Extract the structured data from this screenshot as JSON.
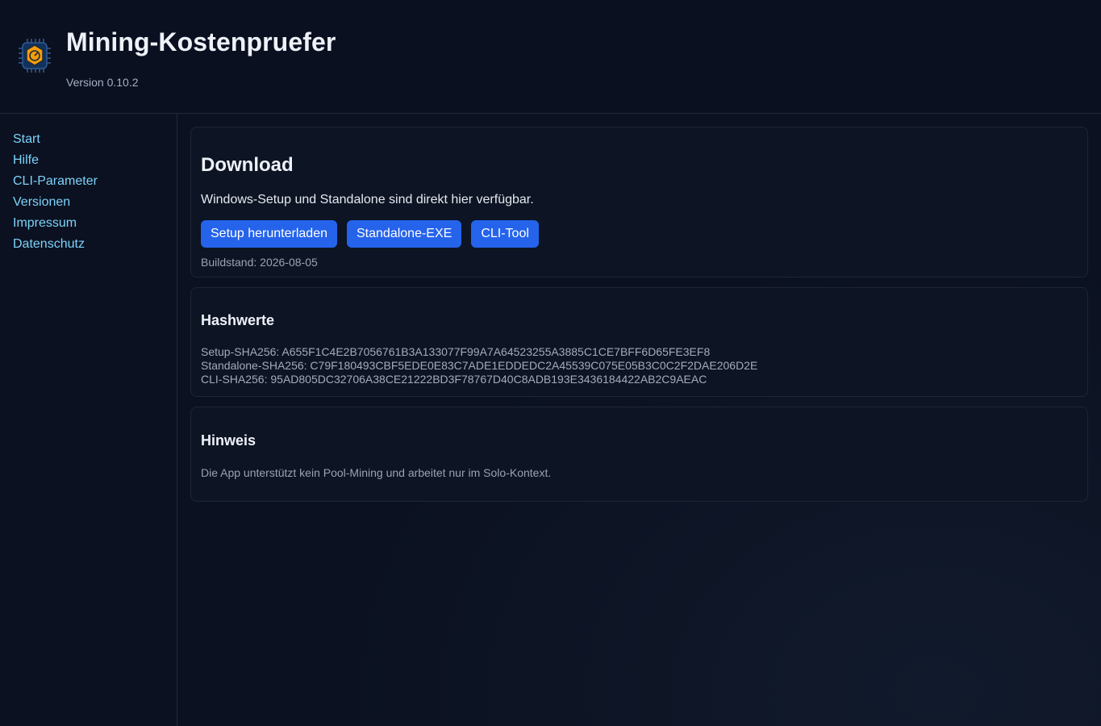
{
  "header": {
    "title": "Mining-Kostenpruefer",
    "version": "Version 0.10.2",
    "logo_icon": "chip-gauge-icon"
  },
  "sidebar": {
    "items": [
      {
        "label": "Start"
      },
      {
        "label": "Hilfe"
      },
      {
        "label": "CLI-Parameter"
      },
      {
        "label": "Versionen"
      },
      {
        "label": "Impressum"
      },
      {
        "label": "Datenschutz"
      }
    ]
  },
  "download": {
    "heading": "Download",
    "description": "Windows-Setup und Standalone sind direkt hier verfügbar.",
    "buttons": [
      {
        "label": "Setup herunterladen"
      },
      {
        "label": "Standalone-EXE"
      },
      {
        "label": "CLI-Tool"
      }
    ],
    "build": "Buildstand: 2026-08-05"
  },
  "hashes": {
    "heading": "Hashwerte",
    "lines": [
      "Setup-SHA256: A655F1C4E2B7056761B3A133077F99A7A64523255A3885C1CE7BFF6D65FE3EF8",
      "Standalone-SHA256: C79F180493CBF5EDE0E83C7ADE1EDDEDC2A45539C075E05B3C0C2F2DAE206D2E",
      "CLI-SHA256: 95AD805DC32706A38CE21222BD3F78767D40C8ADB193E3436184422AB2C9AEAC"
    ]
  },
  "note": {
    "heading": "Hinweis",
    "text": "Die App unterstützt kein Pool-Mining und arbeitet nur im Solo-Kontext."
  },
  "colors": {
    "background": "#0b1120",
    "accent_button": "#2563eb",
    "link": "#7dd3fc",
    "logo_orange": "#f59e0b"
  }
}
